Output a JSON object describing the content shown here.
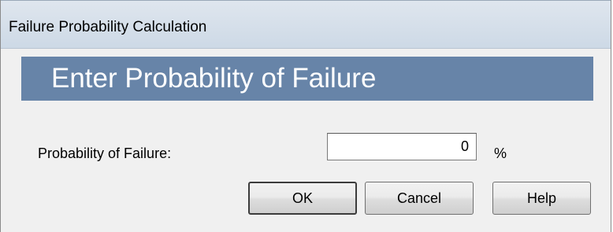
{
  "window": {
    "title": "Failure Probability Calculation"
  },
  "banner": {
    "heading": "Enter Probability of Failure"
  },
  "form": {
    "probability_label": "Probability of Failure:",
    "probability_value": "0",
    "unit": "%"
  },
  "buttons": {
    "ok_label": "OK",
    "cancel_label": "Cancel",
    "help_label": "Help"
  },
  "colors": {
    "banner_background": "#6784a8",
    "titlebar_background": "#cdd9e6",
    "dialog_background": "#f0f0f0"
  }
}
